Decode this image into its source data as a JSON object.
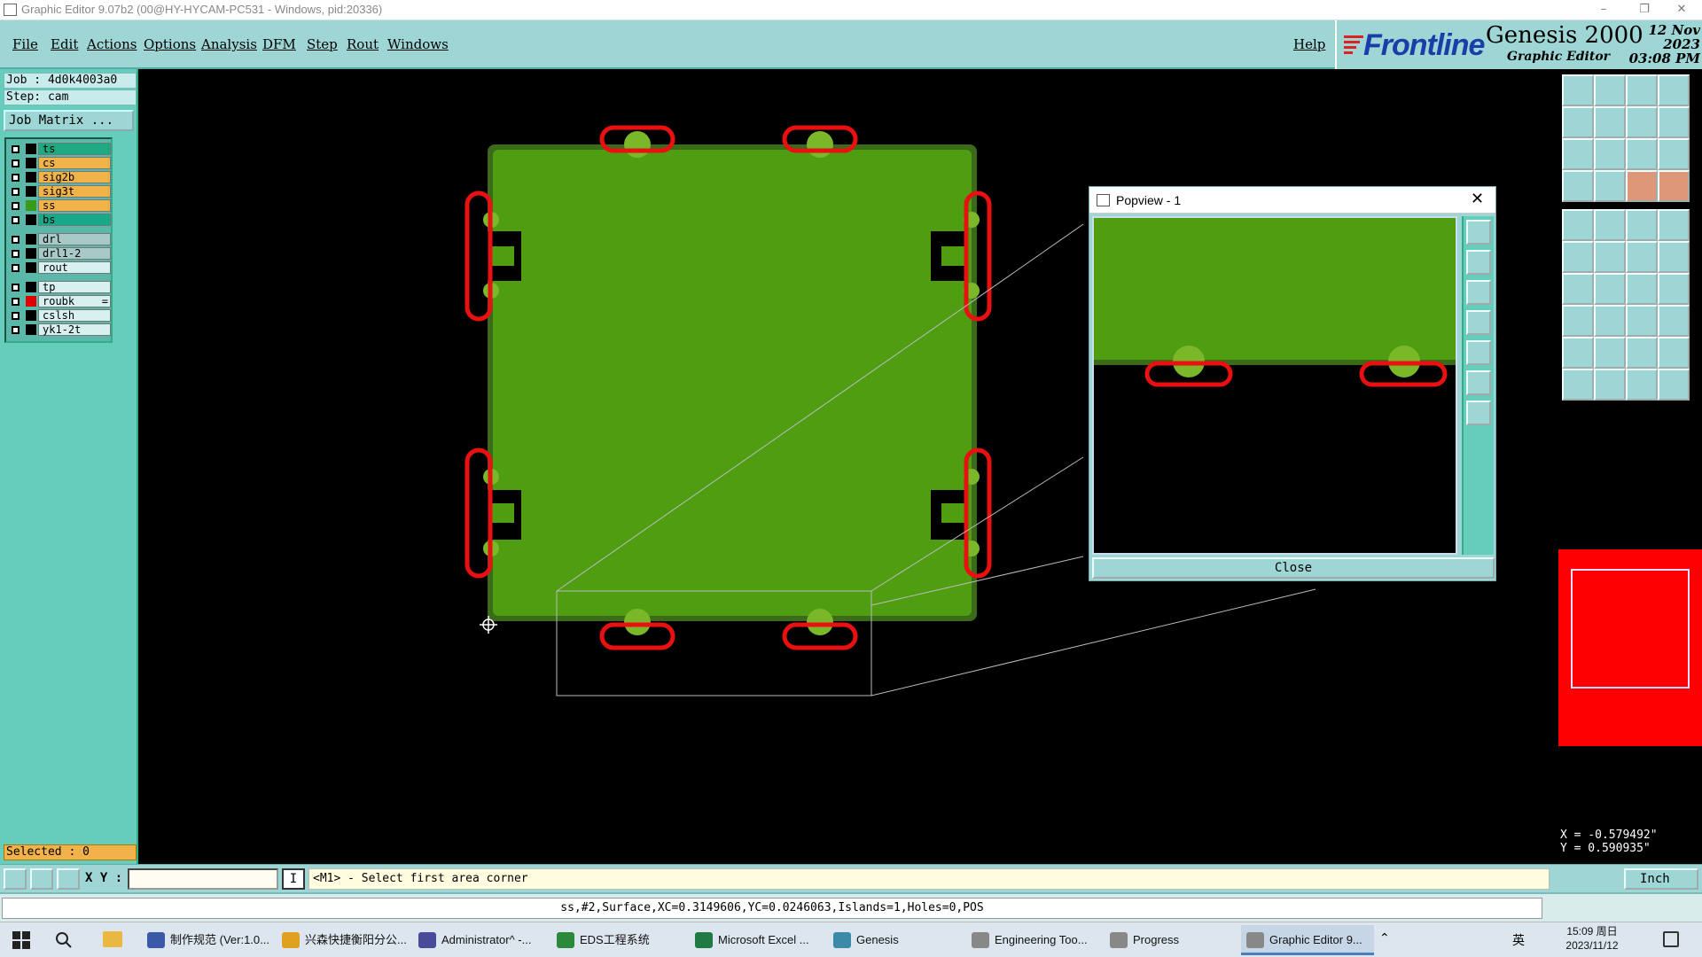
{
  "window": {
    "title": "Graphic Editor 9.07b2 (00@HY-HYCAM-PC531 - Windows, pid:20336)",
    "controls": [
      "–",
      "❐",
      "✕"
    ]
  },
  "menu": [
    "File",
    "Edit",
    "Actions",
    "Options",
    "Analysis",
    "DFM",
    "Step",
    "Rout",
    "Windows"
  ],
  "help": "Help",
  "brand": {
    "logo": "Frontline",
    "product": "Genesis 2000",
    "subtitle": "Graphic Editor",
    "date": "12 Nov 2023",
    "time": "03:08 PM"
  },
  "job": {
    "job_line": "Job : 4d0k4003a0",
    "step_line": "Step: cam",
    "matrix_button": "Job Matrix ..."
  },
  "layers": [
    {
      "name": "ts",
      "color": "#1aa88a",
      "swatch": "#000000",
      "box": "#20a880"
    },
    {
      "name": "cs",
      "color": "#f2b24a",
      "swatch": "#000000",
      "box": "#f2b24a"
    },
    {
      "name": "sig2b",
      "color": "#f2b24a",
      "swatch": "#000000",
      "box": "#f2b24a"
    },
    {
      "name": "sig3t",
      "color": "#f2b24a",
      "swatch": "#000000",
      "box": "#f2b24a"
    },
    {
      "name": "ss",
      "color": "#f2b24a",
      "swatch": "#3a9a1a",
      "box": "#f2b24a"
    },
    {
      "name": "bs",
      "color": "#1aa88a",
      "swatch": "#000000",
      "box": "#1aa88a"
    },
    {
      "name": "drl",
      "color": "#8ab4b4",
      "swatch": "#000000",
      "box": "#a9c8c8"
    },
    {
      "name": "drl1-2",
      "color": "#8ab4b4",
      "swatch": "#000000",
      "box": "#a9c8c8"
    },
    {
      "name": "rout",
      "color": "#c8ecec",
      "swatch": "#000000",
      "box": "#d8f0f0"
    },
    {
      "name": "tp",
      "color": "#c8ecec",
      "swatch": "#000000",
      "box": "#d8f0f0"
    },
    {
      "name": "roubk",
      "color": "#c8ecec",
      "swatch": "#e00000",
      "box": "#d8f0f0",
      "flag": "="
    },
    {
      "name": "cslsh",
      "color": "#c8ecec",
      "swatch": "#000000",
      "box": "#d8f0f0"
    },
    {
      "name": "yk1-2t",
      "color": "#c8ecec",
      "swatch": "#000000",
      "box": "#d8f0f0"
    }
  ],
  "selected": "Selected : 0",
  "popview": {
    "title": "Popview - 1",
    "close": "Close"
  },
  "coords": {
    "x": "X = -0.579492\"",
    "y": "Y = 0.590935\""
  },
  "cmd": {
    "xy_label": "X Y :",
    "prompt": "<M1> - Select first area corner",
    "units": "Inch"
  },
  "status": "ss,#2,Surface,XC=0.3149606,YC=0.0246063,Islands=1,Holes=0,POS",
  "taskbar": [
    {
      "label": "制作规范 (Ver:1.0...",
      "icon": "#3a5aa8"
    },
    {
      "label": "兴森快捷衡阳分公...",
      "icon": "#e0a020"
    },
    {
      "label": "Administrator^ -...",
      "icon": "#4a4a9a"
    },
    {
      "label": "EDS工程系统",
      "icon": "#2a8a3a"
    },
    {
      "label": "Microsoft Excel ...",
      "icon": "#1f7a44"
    },
    {
      "label": "Genesis",
      "icon": "#3a8aa8"
    },
    {
      "label": "Engineering Too...",
      "icon": "#888888"
    },
    {
      "label": "Progress",
      "icon": "#888888"
    },
    {
      "label": "Graphic Editor 9...",
      "icon": "#888888"
    }
  ],
  "tray": {
    "ime": "英",
    "time": "15:09 周日",
    "date": "2023/11/12"
  },
  "colors": {
    "board": "#4f9e12",
    "board_edge": "#3a6a1a",
    "pad": "#7ab82a",
    "rout_slot": "#e81010",
    "panel_teal": "#9ed6d6",
    "overview": "#ff0000"
  }
}
